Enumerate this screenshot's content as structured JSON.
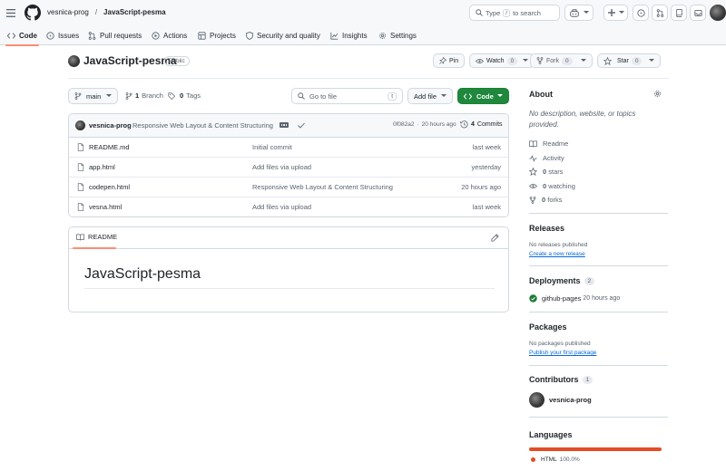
{
  "header": {
    "owner": "vesnica-prog",
    "separator": "/",
    "repo": "JavaScript-pesma",
    "search_prefix": "Type",
    "search_key": "/",
    "search_suffix": "to search"
  },
  "tabs": [
    {
      "label": "Code"
    },
    {
      "label": "Issues"
    },
    {
      "label": "Pull requests"
    },
    {
      "label": "Actions"
    },
    {
      "label": "Projects"
    },
    {
      "label": "Security and quality"
    },
    {
      "label": "Insights"
    },
    {
      "label": "Settings"
    }
  ],
  "repo": {
    "name": "JavaScript-pesma",
    "visibility": "Public",
    "pin_label": "Pin",
    "watch_label": "Watch",
    "watch_count": "0",
    "fork_label": "Fork",
    "fork_count": "0",
    "star_label": "Star",
    "star_count": "0"
  },
  "toolbar": {
    "branch": "main",
    "branches_count": "1",
    "branches_label": "Branch",
    "tags_count": "0",
    "tags_label": "Tags",
    "goto_placeholder": "Go to file",
    "goto_key": "t",
    "add_file_label": "Add file",
    "code_label": "Code"
  },
  "commit": {
    "author": "vesnica-prog",
    "message": "Responsive Web Layout & Content Structuring",
    "hash": "0f082a2",
    "dot": "·",
    "time": "20 hours ago",
    "commits_count": "4",
    "commits_label": "Commits"
  },
  "files": [
    {
      "name": "README.md",
      "message": "Initial commit",
      "time": "last week"
    },
    {
      "name": "app.html",
      "message": "Add files via upload",
      "time": "yesterday"
    },
    {
      "name": "codepen.html",
      "message": "Responsive Web Layout & Content Structuring",
      "time": "20 hours ago"
    },
    {
      "name": "vesna.html",
      "message": "Add files via upload",
      "time": "last week"
    }
  ],
  "readme": {
    "tab_label": "README",
    "heading": "JavaScript-pesma"
  },
  "sidebar": {
    "about_title": "About",
    "about_desc": "No description, website, or topics provided.",
    "readme_label": "Readme",
    "activity_label": "Activity",
    "stars_count": "0",
    "stars_label": "stars",
    "watching_count": "0",
    "watching_label": "watching",
    "forks_count": "0",
    "forks_label": "forks",
    "releases_title": "Releases",
    "releases_text": "No releases published",
    "releases_link": "Create a new release",
    "deployments_title": "Deployments",
    "deployments_count": "2",
    "deployment_name": "github-pages",
    "deployment_time": "20 hours ago",
    "packages_title": "Packages",
    "packages_text": "No packages published",
    "packages_link": "Publish your first package",
    "contributors_title": "Contributors",
    "contributors_count": "1",
    "contributor_name": "vesnica-prog",
    "languages_title": "Languages",
    "language_name": "HTML",
    "language_pct": "100.0%"
  },
  "colors": {
    "accent_tab": "#fd8c73",
    "code_button": "#1f883d",
    "link": "#0969da",
    "html_language": "#e34c26",
    "success": "#1a7f37"
  },
  "language_fraction": 1.0
}
